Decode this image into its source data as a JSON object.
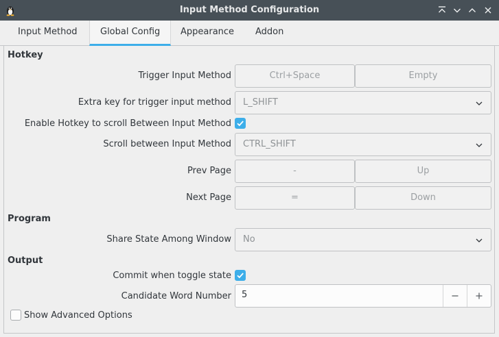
{
  "window": {
    "title": "Input Method Configuration",
    "app_icon": "tux-penguin-icon"
  },
  "titlebar_buttons": [
    "keep-above-icon",
    "minimize-icon",
    "maximize-icon",
    "close-icon"
  ],
  "tabs": [
    {
      "label": "Input Method"
    },
    {
      "label": "Global Config",
      "active": true
    },
    {
      "label": "Appearance"
    },
    {
      "label": "Addon"
    }
  ],
  "hotkey": {
    "section": "Hotkey",
    "trigger": {
      "label": "Trigger Input Method",
      "key1": "Ctrl+Space",
      "key2": "Empty"
    },
    "extra_key": {
      "label": "Extra key for trigger input method",
      "value": "L_SHIFT"
    },
    "enable_scroll": {
      "label": "Enable Hotkey to scroll Between Input Method",
      "checked": true
    },
    "scroll": {
      "label": "Scroll between Input Method",
      "value": "CTRL_SHIFT"
    },
    "prev_page": {
      "label": "Prev Page",
      "key1": "-",
      "key2": "Up"
    },
    "next_page": {
      "label": "Next Page",
      "key1": "=",
      "key2": "Down"
    }
  },
  "program": {
    "section": "Program",
    "share_state": {
      "label": "Share State Among Window",
      "value": "No"
    }
  },
  "output": {
    "section": "Output",
    "commit_toggle": {
      "label": "Commit when toggle state",
      "checked": true
    },
    "candidate": {
      "label": "Candidate Word Number",
      "value": "5"
    }
  },
  "advanced": {
    "label": "Show Advanced Options",
    "checked": false
  },
  "colors": {
    "accent": "#3daee9",
    "titlebar": "#475057",
    "background": "#efefef"
  }
}
